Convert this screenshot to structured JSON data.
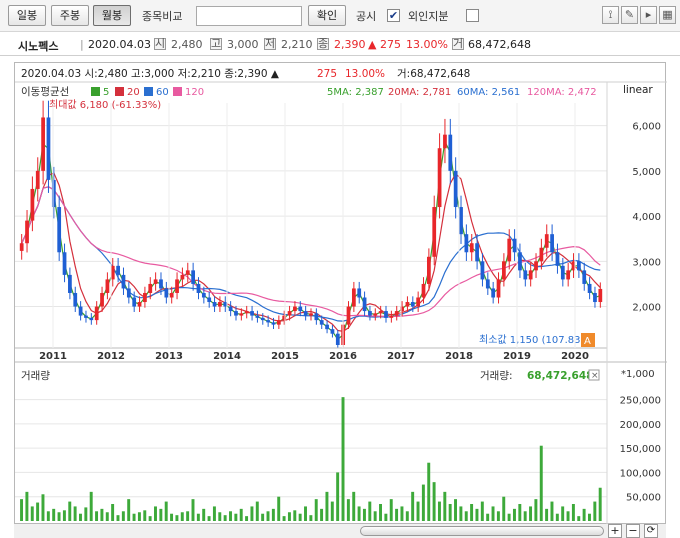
{
  "toolbar": {
    "daily": "일봉",
    "weekly": "주봉",
    "monthly": "월봉",
    "compare_label": "종목비교",
    "search_value": "",
    "confirm": "확인",
    "notice_label": "공시",
    "foreign_label": "외인지분",
    "notice_checked": "✔",
    "foreign_checked": ""
  },
  "info": {
    "name": "시노펙스",
    "date": "2020.04.03",
    "open_tag": "시",
    "open": "2,480",
    "high_tag": "고",
    "high": "3,000",
    "low_tag": "저",
    "low": "2,210",
    "close_tag": "종",
    "close": "2,390",
    "change": "▲ 275",
    "change_pct": "13.00%",
    "volume_tag": "거",
    "volume": "68,472,648"
  },
  "chart_header": {
    "text": "2020.04.03 시:2,480 고:3,000 저:2,210 종:2,390 ▲",
    "change": "275",
    "pct": "13.00%",
    "vol": "거:68,472,648"
  },
  "colors": {
    "up": "#e8262a",
    "down": "#1f5fd4",
    "ma5": "#39a02d",
    "ma20": "#d4303c",
    "ma60": "#2a6fd0",
    "ma120": "#e85aa0",
    "volume": "#3da93a"
  },
  "legend": {
    "title": "이동평균선",
    "ma5": "5",
    "ma20": "20",
    "ma60": "60",
    "ma120": "120",
    "scale": "linear",
    "ma5_value": "5MA: 2,387",
    "ma20_value": "20MA: 2,781",
    "ma60_value": "60MA: 2,561",
    "ma120_value": "120MA: 2,472"
  },
  "annotations": {
    "max_label": "최대값 6,180 (-61.33%)",
    "min_label": "최소값 1,150 (107.83%)",
    "current_badge": "A"
  },
  "volume_panel": {
    "label": "거래량",
    "value_label": "거래량:",
    "value": "68,472,648",
    "unit": "*1,000"
  },
  "chart_data": {
    "type": "candlestick",
    "price_axis": {
      "min": 1150,
      "max": 6500,
      "ticks": [
        "2,000",
        "3,000",
        "4,000",
        "5,000",
        "6,000"
      ]
    },
    "volume_axis": {
      "min": 0,
      "max": 280000,
      "ticks": [
        "50,000",
        "100,000",
        "150,000",
        "200,000",
        "250,000"
      ]
    },
    "x_labels": [
      "2011",
      "2012",
      "2013",
      "2014",
      "2015",
      "2016",
      "2017",
      "2018",
      "2019",
      "2020"
    ],
    "close_series": [
      3400,
      3900,
      4600,
      5000,
      6180,
      4800,
      4200,
      3200,
      2700,
      2300,
      2000,
      1800,
      1750,
      1700,
      2000,
      2300,
      2600,
      2900,
      2700,
      2400,
      2200,
      2000,
      2100,
      2300,
      2500,
      2600,
      2400,
      2200,
      2300,
      2600,
      2700,
      2800,
      2500,
      2300,
      2200,
      2100,
      2000,
      2100,
      2000,
      1900,
      1800,
      1850,
      1900,
      1800,
      1750,
      1700,
      1650,
      1600,
      1700,
      1800,
      1900,
      2000,
      1900,
      1800,
      1850,
      1700,
      1600,
      1500,
      1400,
      1150,
      1600,
      2000,
      2400,
      2200,
      1900,
      1800,
      1850,
      1900,
      1750,
      1800,
      1900,
      2000,
      2100,
      2000,
      2200,
      2500,
      3100,
      4200,
      5500,
      5800,
      5000,
      4200,
      3600,
      3200,
      3400,
      3000,
      2600,
      2400,
      2200,
      2600,
      3000,
      3500,
      3200,
      2800,
      2600,
      2800,
      3000,
      3300,
      3600,
      3200,
      2900,
      2600,
      2800,
      3000,
      2800,
      2500,
      2300,
      2100,
      2390
    ],
    "volume_series": [
      45000,
      60000,
      30000,
      38000,
      55000,
      20000,
      25000,
      18000,
      22000,
      40000,
      30000,
      15000,
      28000,
      60000,
      20000,
      25000,
      18000,
      35000,
      12000,
      20000,
      45000,
      15000,
      18000,
      22000,
      10000,
      30000,
      25000,
      40000,
      15000,
      12000,
      18000,
      20000,
      45000,
      15000,
      25000,
      10000,
      30000,
      18000,
      12000,
      20000,
      15000,
      25000,
      10000,
      30000,
      40000,
      15000,
      20000,
      25000,
      50000,
      10000,
      18000,
      22000,
      15000,
      30000,
      12000,
      45000,
      25000,
      60000,
      40000,
      100000,
      255000,
      45000,
      60000,
      30000,
      25000,
      40000,
      20000,
      35000,
      15000,
      45000,
      25000,
      30000,
      20000,
      60000,
      40000,
      75000,
      120000,
      80000,
      40000,
      60000,
      35000,
      45000,
      30000,
      20000,
      35000,
      25000,
      40000,
      15000,
      30000,
      20000,
      50000,
      15000,
      25000,
      35000,
      20000,
      30000,
      45000,
      155000,
      25000,
      40000,
      15000,
      30000,
      20000,
      35000,
      10000,
      25000,
      15000,
      40000,
      68473
    ]
  }
}
